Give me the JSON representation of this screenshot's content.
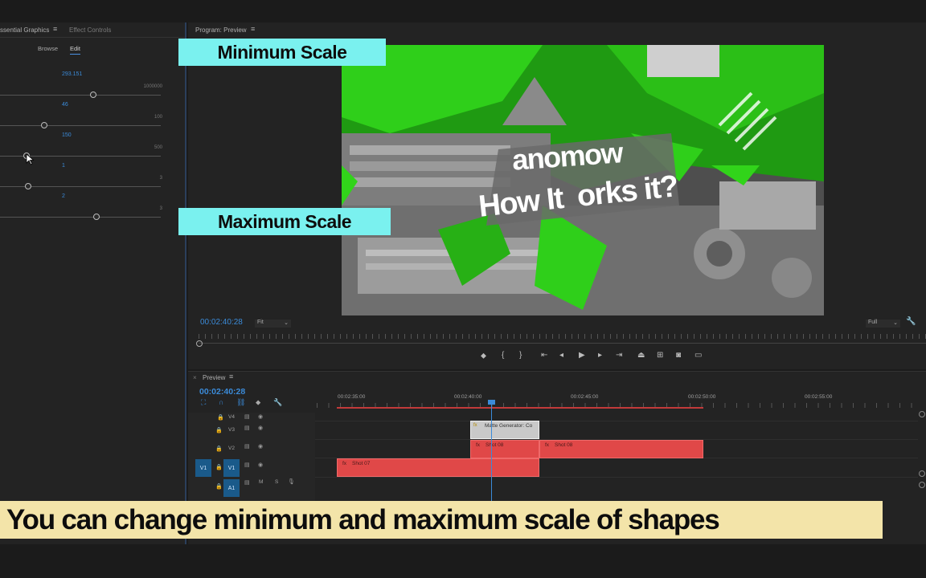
{
  "essential_graphics": {
    "tab_title": "ssential Graphics",
    "tab_effect": "Effect Controls",
    "browse": "Browse",
    "edit": "Edit",
    "params": [
      {
        "value": "293.151",
        "max": "1000000",
        "level": 0.116
      },
      {
        "value": "46",
        "max": "100",
        "level": 0.46
      },
      {
        "value": "150",
        "max": "500",
        "level": 0.3
      },
      {
        "value": "1",
        "max": "3",
        "level": 0.33
      },
      {
        "value": "2",
        "max": "3",
        "level": 0.66
      }
    ]
  },
  "program": {
    "title": "Program: Preview",
    "timecode": "00:02:40:28",
    "fit": "Fit",
    "quality": "Full",
    "video_text_line1": "anomow",
    "video_text_line2": "How It  orks it?"
  },
  "callouts": {
    "min": "Minimum Scale",
    "max": "Maximum Scale"
  },
  "timeline": {
    "title": "Preview",
    "timecode": "00:02:40:28",
    "ruler": [
      "00:02:35:00",
      "00:02:40:00",
      "00:02:45:00",
      "00:02:50:00",
      "00:02:55:00"
    ],
    "tracks": {
      "v4": "V4",
      "v3": "V3",
      "v2": "V2",
      "v1": "V1",
      "a1": "A1",
      "m": "M",
      "s": "S",
      "src_v1": "V1"
    },
    "clips": {
      "matte": "Matte Generator: Co",
      "shot08a": "Shot 08",
      "shot08b": "Shot 08",
      "shot07": "Shot 07"
    }
  },
  "caption": "You can change minimum and maximum scale of shapes",
  "colors": {
    "accent": "#3b8bd9",
    "clip": "#e04848",
    "callout": "#7af1ef",
    "caption": "#f3e4a9",
    "green": "#31d41a"
  }
}
